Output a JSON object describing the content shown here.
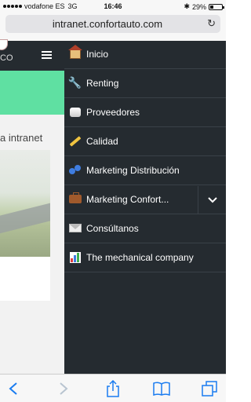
{
  "status_bar": {
    "carrier": "vodafone ES",
    "network": "3G",
    "time": "16:46",
    "battery": "29%",
    "battery_level": 0.29
  },
  "url_bar": {
    "url": "intranet.confortauto.com",
    "reload_icon": "reload-icon"
  },
  "site": {
    "logo_text": "CO",
    "welcome_text": "a intranet",
    "accent_color": "#5fe0a2",
    "header_color": "#252b30"
  },
  "nav": {
    "items": [
      {
        "label": "Inicio",
        "icon": "home-icon"
      },
      {
        "label": "Renting",
        "icon": "wrench-icon"
      },
      {
        "label": "Proveedores",
        "icon": "pipe-icon"
      },
      {
        "label": "Calidad",
        "icon": "pencil-icon"
      },
      {
        "label": "Marketing Distribución",
        "icon": "people-icon"
      },
      {
        "label": "Marketing Confort...",
        "icon": "briefcase-icon",
        "expandable": true
      },
      {
        "label": "Consúltanos",
        "icon": "mail-icon"
      },
      {
        "label": "The mechanical company",
        "icon": "chart-icon"
      }
    ]
  },
  "toolbar": {
    "buttons": [
      "back-icon",
      "forward-icon",
      "share-icon",
      "bookmarks-icon",
      "tabs-icon"
    ],
    "accent": "#1a7cf0"
  }
}
